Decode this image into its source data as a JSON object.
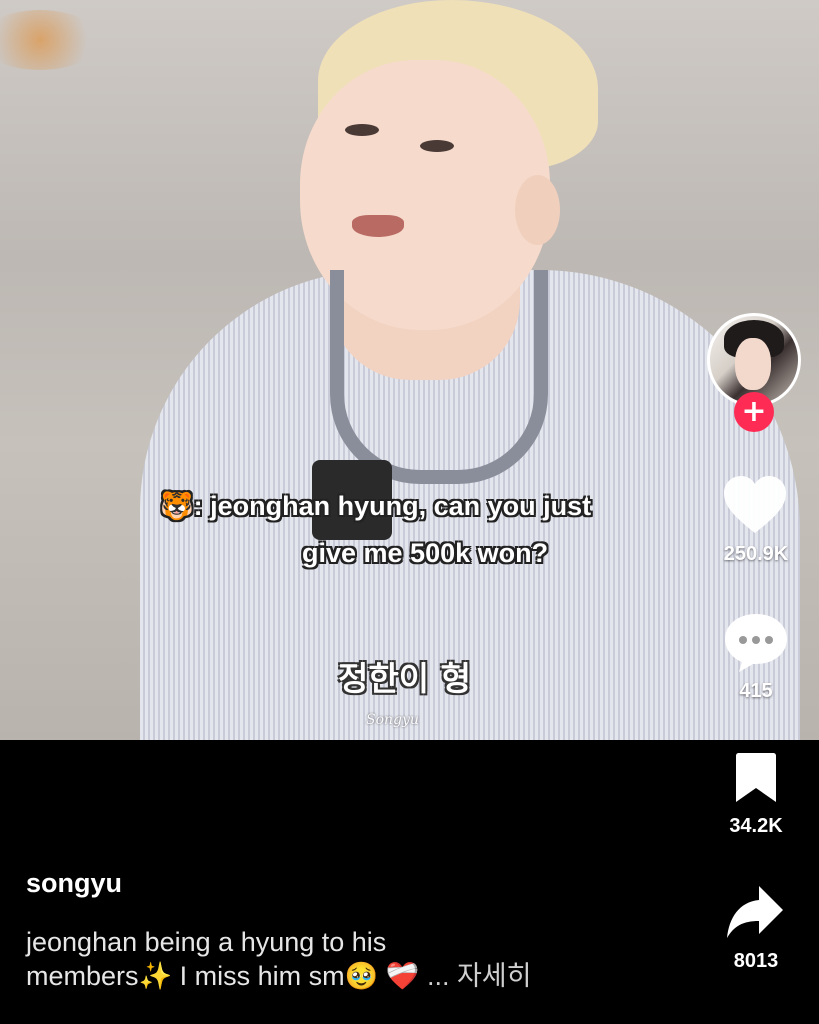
{
  "video": {
    "caption_line1": "🐯: jeonghan hyung, can you just",
    "caption_line2": "give me 500k won?",
    "subtitle_korean": "정한이 형",
    "watermark": "Songyu"
  },
  "rail": {
    "follow_symbol": "+",
    "likes": "250.9K",
    "comments": "415",
    "saves": "34.2K",
    "shares": "8013",
    "colors": {
      "follow": "#fe2c55",
      "icon": "#ffffff"
    }
  },
  "post": {
    "username": "songyu",
    "description_line1": "jeonghan being a hyung to his",
    "description_line2_a": "members",
    "description_sparkle": "✨",
    "description_line2_b": " I miss him sm",
    "description_emoji1": "🥹",
    "description_emoji2": "❤️‍🩹",
    "description_more": "... 자세히"
  }
}
